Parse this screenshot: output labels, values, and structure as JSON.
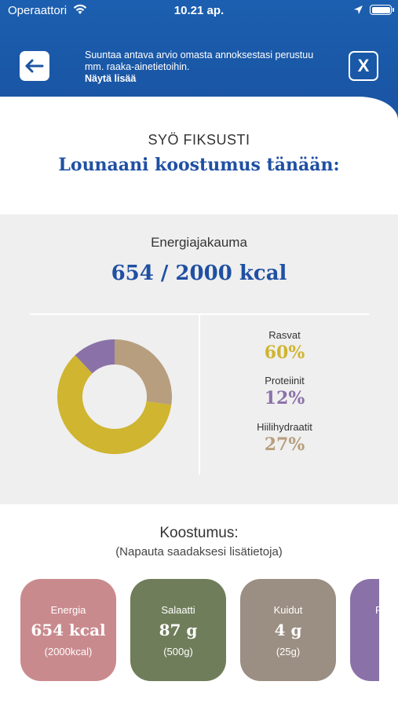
{
  "status_bar": {
    "carrier": "Operaattori",
    "time": "10.21 ap."
  },
  "header": {
    "notice_text": "Suuntaa antava arvio omasta annoksestasi perustuu mm. raaka-ainetietoihin.",
    "notice_more": "Näytä lisää",
    "close_label": "X",
    "back_icon": "arrow-left-icon"
  },
  "intro": {
    "kicker": "SYÖ FIKSUSTI",
    "title": "Lounaani koostumus tänään:"
  },
  "energy": {
    "label": "Energiajakauma",
    "value": "654 / 2000 kcal",
    "legend": [
      {
        "name": "Rasvat",
        "pct": "60%",
        "color": "#cfb530"
      },
      {
        "name": "Proteiinit",
        "pct": "12%",
        "color": "#8a72a8"
      },
      {
        "name": "Hiilihydraatit",
        "pct": "27%",
        "color": "#b79e7e"
      }
    ]
  },
  "chart_data": {
    "type": "pie",
    "categories": [
      "Rasvat",
      "Proteiinit",
      "Hiilihydraatit"
    ],
    "values": [
      60,
      12,
      27
    ],
    "colors": [
      "#cfb530",
      "#8a72a8",
      "#b79e7e"
    ],
    "donut": true
  },
  "composition": {
    "title": "Koostumus:",
    "subtitle": "(Napauta saadaksesi lisätietoja)",
    "cards": [
      {
        "label": "Energia",
        "value": "654 kcal",
        "ref": "(2000kcal)",
        "color": "#c98a8e"
      },
      {
        "label": "Salaatti",
        "value": "87 g",
        "ref": "(500g)",
        "color": "#6f7d5a"
      },
      {
        "label": "Kuidut",
        "value": "4 g",
        "ref": "(25g)",
        "color": "#9b8e82"
      },
      {
        "label": "P",
        "value": "",
        "ref": "",
        "color": "#8a72a8"
      }
    ]
  }
}
